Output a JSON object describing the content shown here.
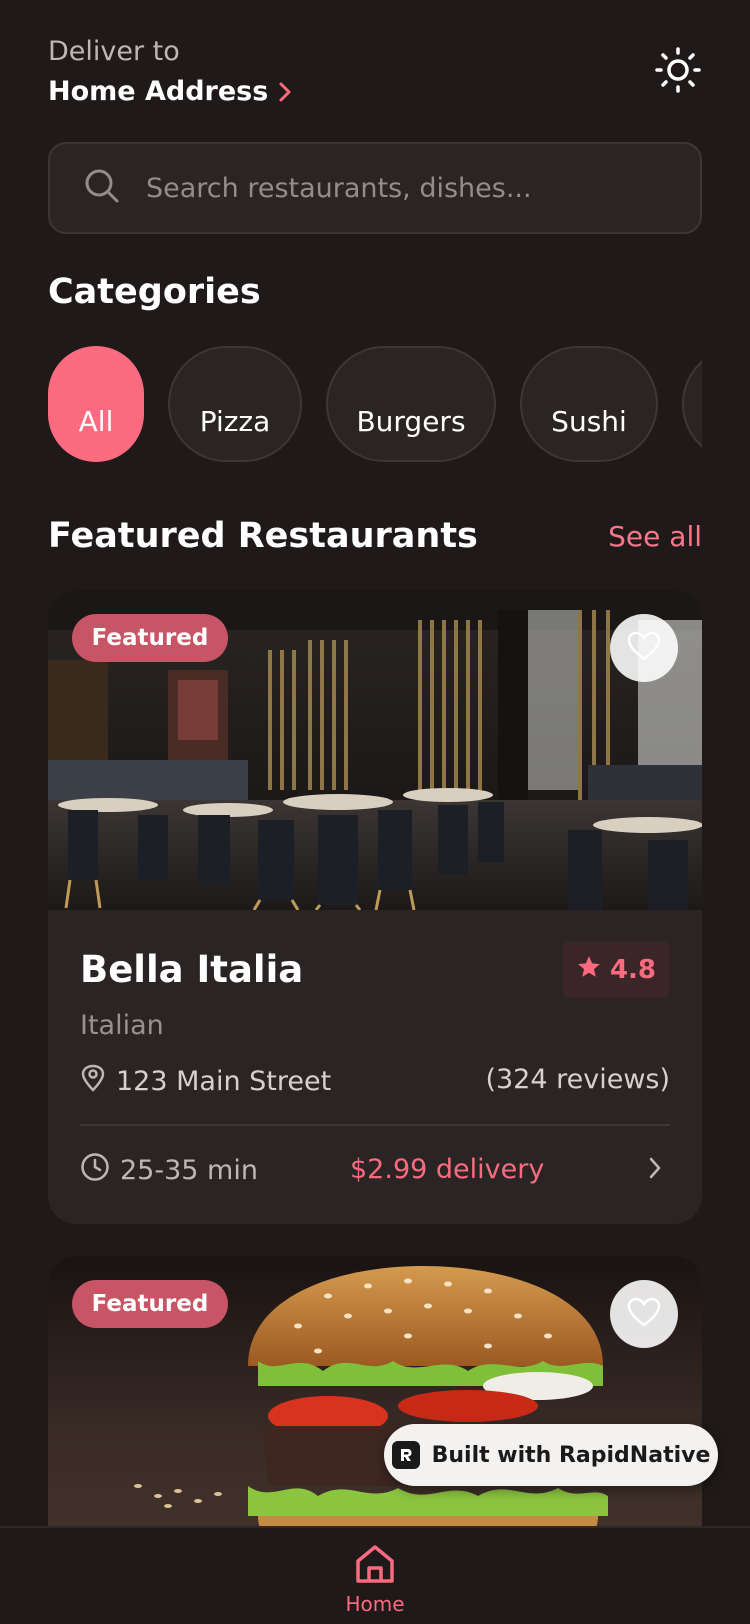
{
  "header": {
    "deliver_label": "Deliver to",
    "address": "Home Address"
  },
  "search": {
    "placeholder": "Search restaurants, dishes..."
  },
  "categories": {
    "title": "Categories",
    "items": [
      "All",
      "Pizza",
      "Burgers",
      "Sushi"
    ],
    "selected": "All"
  },
  "featured": {
    "title": "Featured Restaurants",
    "see_all": "See all",
    "cards": [
      {
        "badge": "Featured",
        "name": "Bella Italia",
        "rating": "4.8",
        "cuisine": "Italian",
        "address": "123 Main Street",
        "reviews": "(324 reviews)",
        "time": "25-35 min",
        "fee": "$2.99 delivery"
      },
      {
        "badge": "Featured"
      }
    ]
  },
  "built_with": "Built with RapidNative",
  "tabbar": {
    "home_label": "Home"
  },
  "colors": {
    "accent": "#fb6b80",
    "background": "#1f1a19",
    "card": "#2a2524"
  }
}
